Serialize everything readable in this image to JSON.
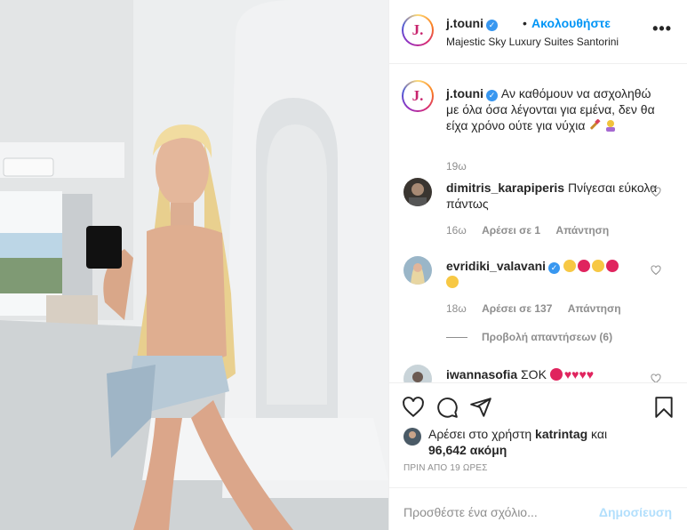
{
  "header": {
    "username": "j.touni",
    "avatar_letter": "J.",
    "separator": "•",
    "follow_label": "Ακολουθήστε",
    "location": "Majestic Sky Luxury Suites Santorini",
    "more_label": "•••"
  },
  "caption": {
    "username": "j.touni",
    "text": "Αν καθόμουν να ασχοληθώ με όλα όσα λέγονται για εμένα, δεν θα είχα χρόνο ούτε για νύχια",
    "time": "19ω"
  },
  "comments": [
    {
      "username": "dimitris_karapiperis",
      "text": "Πνίγεσαι εύκολα πάντως",
      "time": "16ω",
      "likes": "Αρέσει σε 1",
      "reply": "Απάντηση"
    },
    {
      "username": "evridiki_valavani",
      "text": "",
      "time": "18ω",
      "likes": "Αρέσει σε 137",
      "reply": "Απάντηση",
      "view_replies": "Προβολή απαντήσεων (6)"
    },
    {
      "username": "iwannasofia",
      "text": "ΣΟΚ"
    }
  ],
  "likes": {
    "prefix": "Αρέσει στο χρήστη",
    "user": "katrintag",
    "conj": "και",
    "count": "96,642",
    "suffix": "ακόμη"
  },
  "timestamp": "ΠΡΙΝ ΑΠΟ 19 ΩΡΕΣ",
  "add_comment": {
    "placeholder": "Προσθέστε ένα σχόλιο...",
    "post_label": "Δημοσίευση"
  },
  "colors": {
    "accent": "#0095f6",
    "verified": "#3897f0",
    "muted": "#8e8e8e",
    "post_disabled": "#b2dffc"
  }
}
